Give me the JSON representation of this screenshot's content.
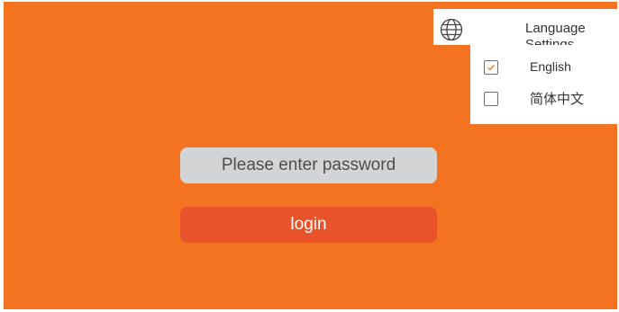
{
  "colors": {
    "background": "#F37321",
    "input_fill": "#D3D4D6",
    "login_button": "#E8532B",
    "panel": "#FFFFFF",
    "check_mark": "#F37321"
  },
  "login": {
    "password_placeholder": "Please enter password",
    "password_value": "",
    "button_label": "login"
  },
  "language_menu": {
    "icon": "globe-icon",
    "title_line1": "Language",
    "title_line2": "Settings",
    "options": [
      {
        "label": "English",
        "checked": true
      },
      {
        "label": "简体中文",
        "checked": false
      }
    ]
  }
}
